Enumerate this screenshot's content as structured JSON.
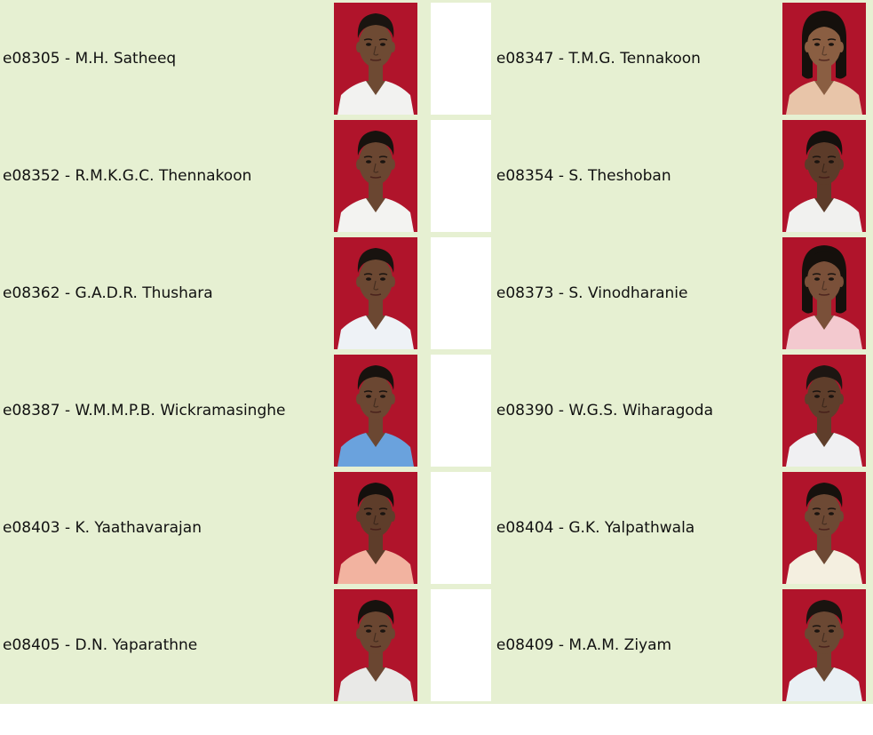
{
  "colors": {
    "cell_bg": "#e6f0d2",
    "cell_border": "#f6f9ef",
    "photo_bg": "#b0142b",
    "text": "#111111"
  },
  "rows": [
    {
      "left": {
        "label": "e08305 - M.H. Satheeq",
        "shirt": "#f2f2f0",
        "skin": "#6e4a33",
        "hair": "#1a1410",
        "female": false
      },
      "right": {
        "label": "e08347 - T.M.G. Tennakoon",
        "shirt": "#e8c5a9",
        "skin": "#8a5e42",
        "hair": "#15100c",
        "female": true
      }
    },
    {
      "left": {
        "label": "e08352 - R.M.K.G.C. Thennakoon",
        "shirt": "#f3f3f1",
        "skin": "#6a4631",
        "hair": "#17120e",
        "female": false
      },
      "right": {
        "label": "e08354 - S. Theshoban",
        "shirt": "#f1f1ef",
        "skin": "#5c3b29",
        "hair": "#14100d",
        "female": false
      }
    },
    {
      "left": {
        "label": "e08362 - G.A.D.R. Thushara",
        "shirt": "#eef2f6",
        "skin": "#6c4832",
        "hair": "#18130f",
        "female": false
      },
      "right": {
        "label": "e08373 - S. Vinodharanie",
        "shirt": "#f3c9cf",
        "skin": "#7a5039",
        "hair": "#15100c",
        "female": true
      }
    },
    {
      "left": {
        "label": "e08387 - W.M.M.P.B. Wickramasinghe",
        "shirt": "#6aa2dd",
        "skin": "#6b4732",
        "hair": "#17120e",
        "female": false
      },
      "right": {
        "label": "e08390 - W.G.S. Wiharagoda",
        "shirt": "#f0f0f2",
        "skin": "#5f3e2b",
        "hair": "#1d1612",
        "female": false
      }
    },
    {
      "left": {
        "label": "e08403 - K. Yaathavarajan",
        "shirt": "#f2b3a0",
        "skin": "#5e3d2a",
        "hair": "#14100d",
        "female": false
      },
      "right": {
        "label": "e08404 - G.K. Yalpathwala",
        "shirt": "#f4efe0",
        "skin": "#6d4934",
        "hair": "#16110d",
        "female": false
      }
    },
    {
      "left": {
        "label": "e08405 - D.N. Yaparathne",
        "shirt": "#e9e9e7",
        "skin": "#6a4631",
        "hair": "#17120e",
        "female": false
      },
      "right": {
        "label": "e08409 - M.A.M. Ziyam",
        "shirt": "#eaf0f4",
        "skin": "#6b4833",
        "hair": "#1a1410",
        "female": false
      }
    }
  ]
}
